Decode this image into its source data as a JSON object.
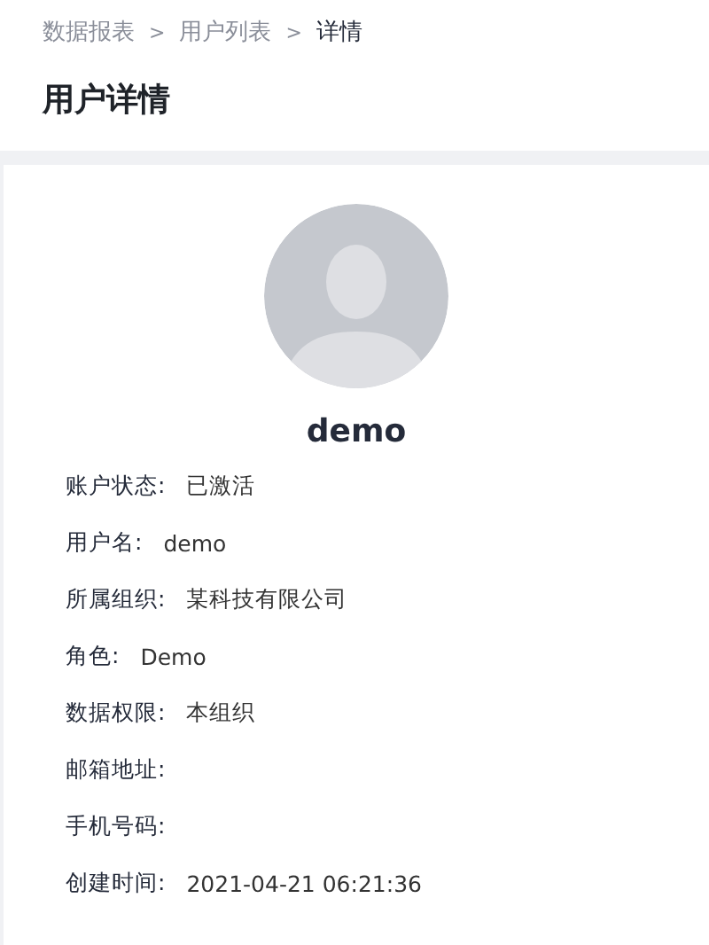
{
  "breadcrumb": [
    {
      "label": "数据报表",
      "current": false
    },
    {
      "label": "用户列表",
      "current": false
    },
    {
      "label": "详情",
      "current": true
    }
  ],
  "breadcrumb_separator": ">",
  "page_title": "用户详情",
  "user": {
    "name": "demo"
  },
  "fields": [
    {
      "label": "账户状态:",
      "value": "已激活"
    },
    {
      "label": "用户名:",
      "value": "demo"
    },
    {
      "label": "所属组织:",
      "value": "某科技有限公司"
    },
    {
      "label": "角色:",
      "value": "Demo"
    },
    {
      "label": "数据权限:",
      "value": "本组织"
    },
    {
      "label": "邮箱地址:"
    },
    {
      "label": "手机号码:"
    },
    {
      "label": "创建时间:",
      "value": "2021-04-21 06:21:36"
    }
  ]
}
